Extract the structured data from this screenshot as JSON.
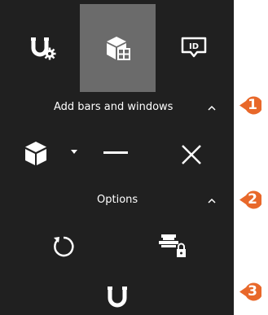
{
  "tabs": [
    {
      "icon": "magnet-gear-icon",
      "active": false
    },
    {
      "icon": "cube-window-icon",
      "active": true
    },
    {
      "icon": "id-tag-icon",
      "active": false
    }
  ],
  "sections": [
    {
      "label": "Add bars and windows",
      "expanded": true
    },
    {
      "label": "Options",
      "expanded": true
    }
  ],
  "tools": {
    "add_bars": [
      "cube-icon",
      "dropdown-arrow-icon",
      "bar-icon",
      "window-close-x-icon"
    ],
    "options": [
      "reset-rotate-icon",
      "lock-settings-icon"
    ],
    "bottom": [
      "magnet-icon"
    ]
  },
  "callouts": [
    "1",
    "2",
    "3"
  ],
  "colors": {
    "panel_bg": "#202020",
    "active_tab_bg": "#6b6b6b",
    "icon": "#ffffff",
    "callout": "#e8682a"
  }
}
